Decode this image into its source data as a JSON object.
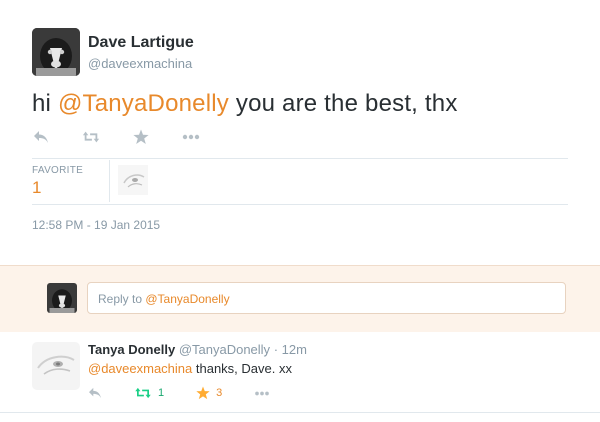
{
  "tweet": {
    "author_name": "Dave Lartigue",
    "author_handle": "@daveexmachina",
    "text_prefix": "hi ",
    "text_mention": "@TanyaDonelly",
    "text_suffix": " you are the best, thx",
    "favorite_label": "FAVORITE",
    "favorite_count": "1",
    "timestamp": "12:58 PM - 19 Jan 2015"
  },
  "actions": {
    "reply_icon": "reply-icon",
    "retweet_icon": "retweet-icon",
    "favorite_icon": "star-icon",
    "more_icon": "more-icon"
  },
  "reply_box": {
    "placeholder_prefix": "Reply to ",
    "placeholder_mention": "@TanyaDonelly"
  },
  "reply": {
    "author_name": "Tanya Donelly",
    "author_handle": "@TanyaDonelly",
    "separator": "·",
    "time": "12m",
    "text_mention": "@daveexmachina",
    "text_body": " thanks, Dave. xx",
    "retweet_count": "1",
    "favorite_count": "3"
  },
  "colors": {
    "accent": "#e8892b",
    "retweet_green": "#19cf86",
    "favorite_orange": "#ffac33",
    "muted": "#8899a6",
    "reply_bg": "#fdf3ea"
  }
}
